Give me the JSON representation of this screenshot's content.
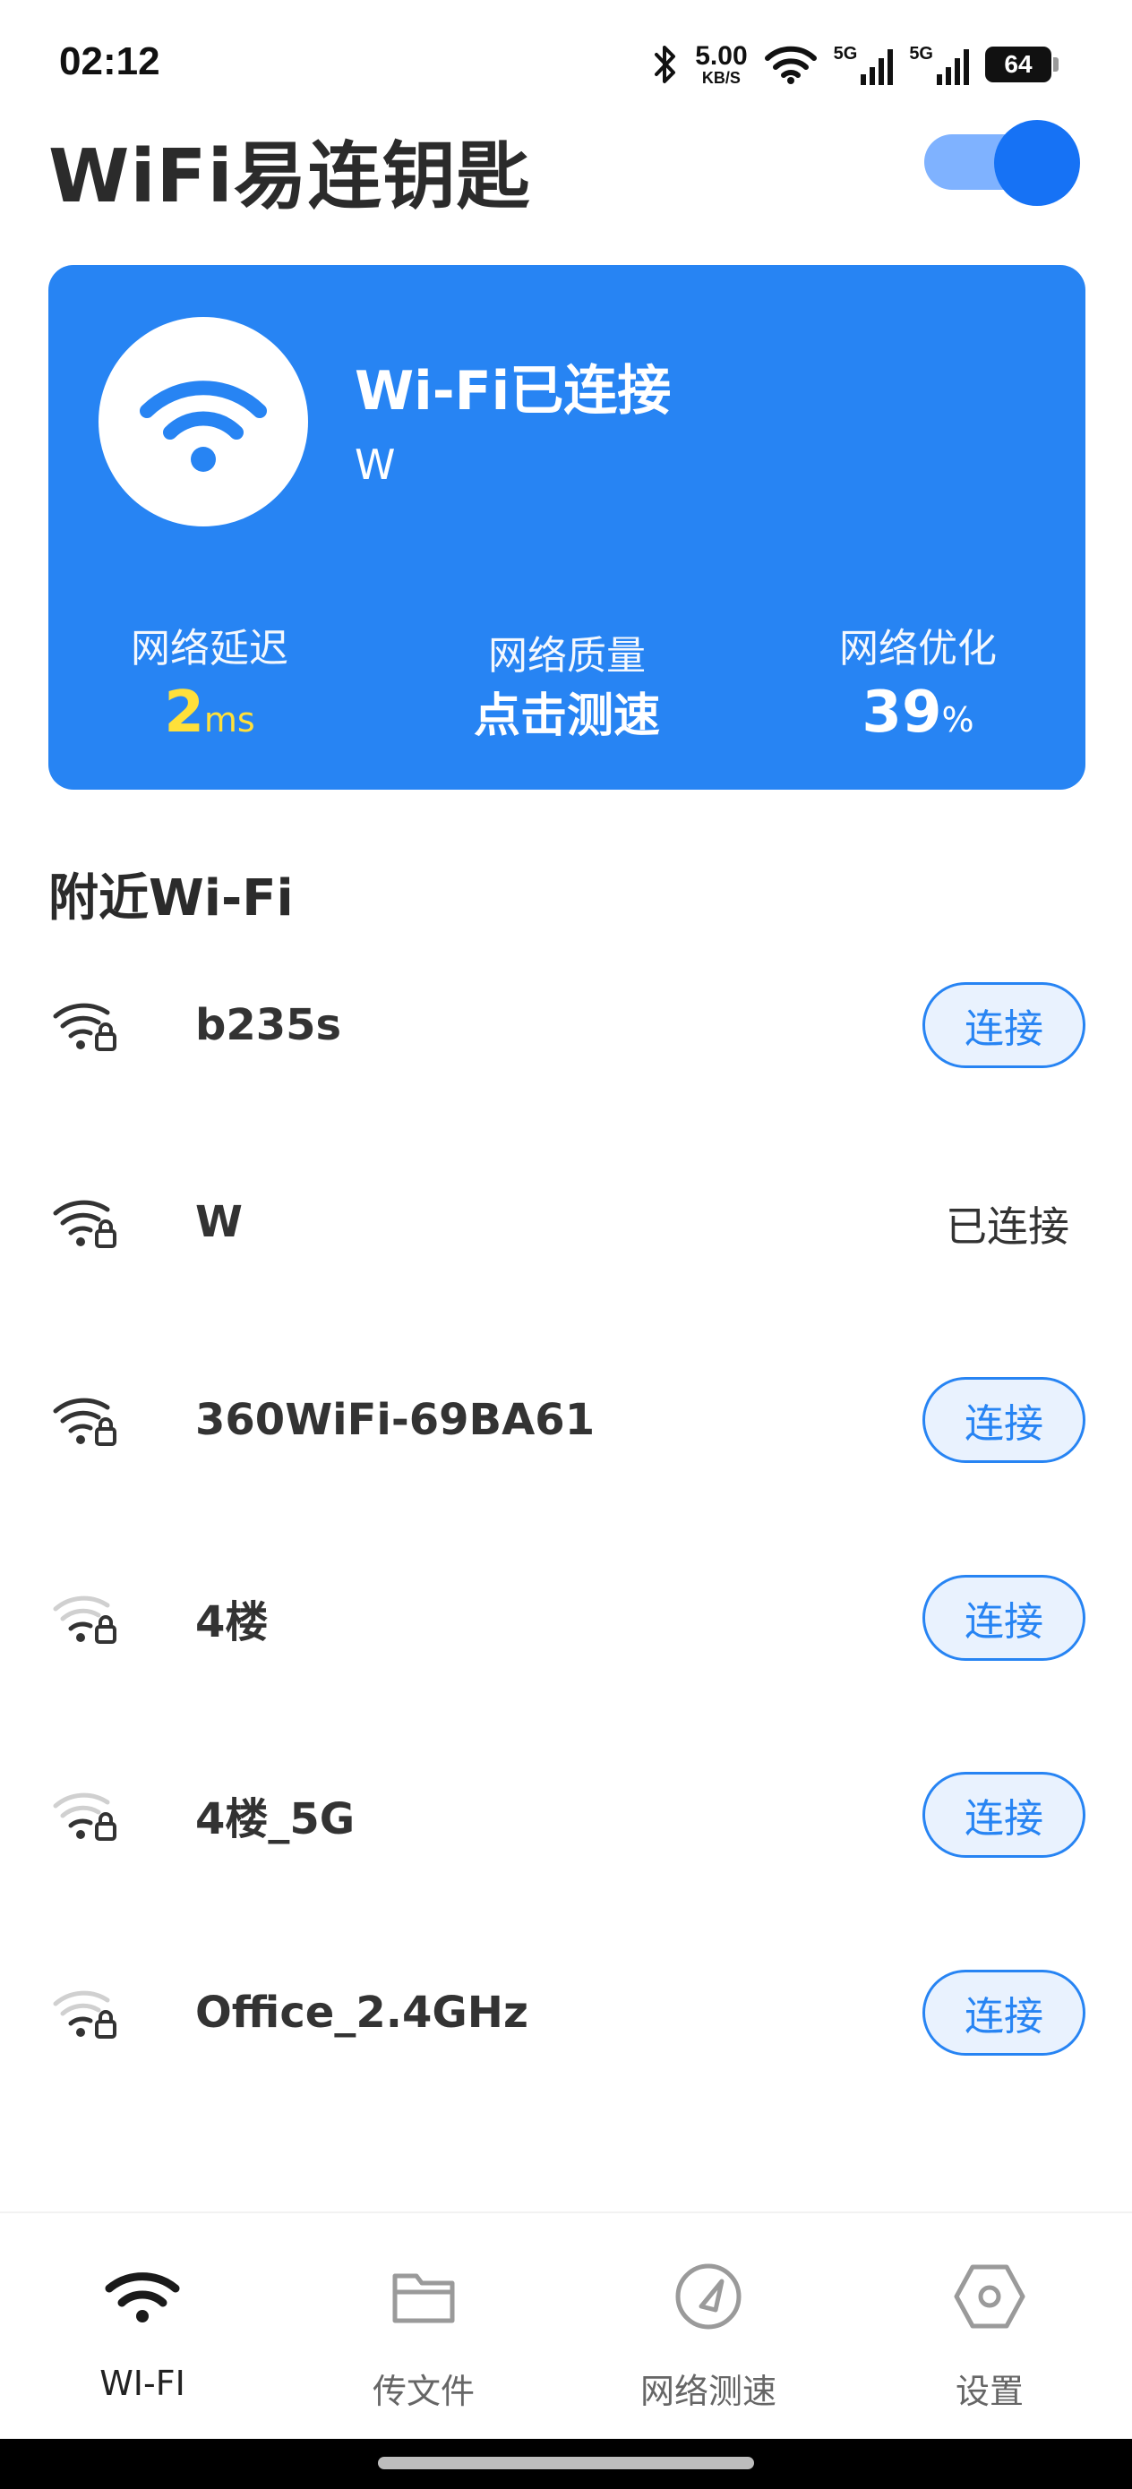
{
  "status_bar": {
    "time": "02:12",
    "net_speed_value": "5.00",
    "net_speed_unit": "KB/S",
    "cell1_label": "5G",
    "cell2_label": "5G",
    "battery": "64"
  },
  "header": {
    "title": "WiFi易连钥匙",
    "toggle_on": true
  },
  "connected_card": {
    "status": "Wi-Fi已连接",
    "ssid": "W",
    "stats": [
      {
        "label": "网络延迟",
        "value": "2",
        "unit": "ms",
        "accent": "#ffe03a"
      },
      {
        "label": "网络质量",
        "value": "点击测速"
      },
      {
        "label": "网络优化",
        "value": "39",
        "unit": "%"
      }
    ]
  },
  "nearby": {
    "title": "附近Wi-Fi",
    "networks": [
      {
        "name": "b235s",
        "action": "连接",
        "signal": "strong"
      },
      {
        "name": "W",
        "status": "已连接",
        "signal": "strong"
      },
      {
        "name": "360WiFi-69BA61",
        "action": "连接",
        "signal": "strong"
      },
      {
        "name": "4楼",
        "action": "连接",
        "signal": "weak"
      },
      {
        "name": "4楼_5G",
        "action": "连接",
        "signal": "weak"
      },
      {
        "name": "Office_2.4GHz",
        "action": "连接",
        "signal": "weak"
      }
    ]
  },
  "bottom_nav": {
    "items": [
      {
        "label": "WI-FI",
        "icon": "wifi-icon",
        "active": true
      },
      {
        "label": "传文件",
        "icon": "folder-icon",
        "active": false
      },
      {
        "label": "网络测速",
        "icon": "speedometer-icon",
        "active": false
      },
      {
        "label": "设置",
        "icon": "hexagon-settings-icon",
        "active": false
      }
    ]
  },
  "colors": {
    "primary": "#2784f3",
    "toggle_knob": "#1672f5",
    "accent_yellow": "#ffe03a"
  }
}
